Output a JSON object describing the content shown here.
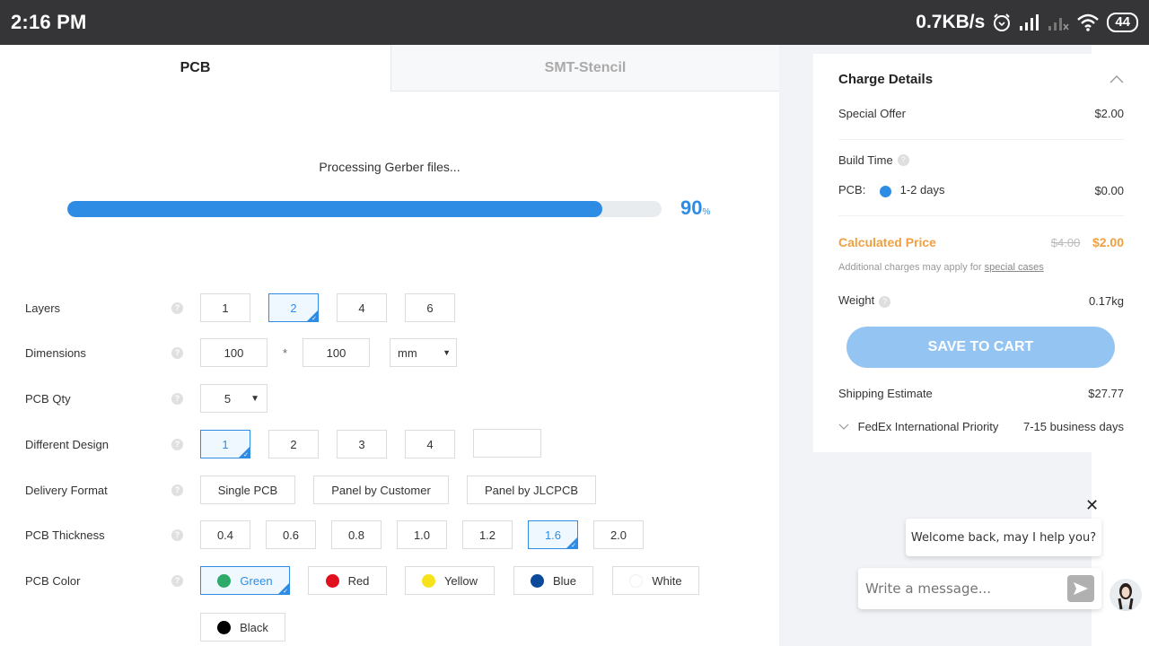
{
  "status_bar": {
    "time": "2:16 PM",
    "net_speed": "0.7KB/s",
    "battery": "44",
    "icons": [
      "alarm-icon",
      "signal-icon",
      "signal-no-service-icon",
      "wifi-icon",
      "battery-icon"
    ]
  },
  "tabs": [
    {
      "label": "PCB",
      "active": true
    },
    {
      "label": "SMT-Stencil",
      "active": false
    }
  ],
  "progress": {
    "label": "Processing Gerber files...",
    "percent": 90,
    "percent_text": "90",
    "percent_unit": "%"
  },
  "form": {
    "layers": {
      "label": "Layers",
      "options": [
        "1",
        "2",
        "4",
        "6"
      ],
      "selected": "2"
    },
    "dimensions": {
      "label": "Dimensions",
      "width": "100",
      "separator": "*",
      "height": "100",
      "unit": "mm"
    },
    "qty": {
      "label": "PCB Qty",
      "value": "5"
    },
    "different_design": {
      "label": "Different Design",
      "options": [
        "1",
        "2",
        "3",
        "4"
      ],
      "selected": "1",
      "custom_value": ""
    },
    "delivery_format": {
      "label": "Delivery Format",
      "options": [
        "Single PCB",
        "Panel by Customer",
        "Panel by JLCPCB"
      ]
    },
    "thickness": {
      "label": "PCB Thickness",
      "options": [
        "0.4",
        "0.6",
        "0.8",
        "1.0",
        "1.2",
        "1.6",
        "2.0"
      ],
      "selected": "1.6"
    },
    "color": {
      "label": "PCB Color",
      "selected": "Green",
      "options": [
        {
          "label": "Green",
          "hex": "#2eaa6a"
        },
        {
          "label": "Red",
          "hex": "#e0101e"
        },
        {
          "label": "Yellow",
          "hex": "#f7e31c"
        },
        {
          "label": "Blue",
          "hex": "#0b4a9a"
        },
        {
          "label": "White",
          "hex": "#ffffff"
        },
        {
          "label": "Black",
          "hex": "#000000"
        }
      ]
    },
    "help_glyph": "?"
  },
  "charge": {
    "title": "Charge Details",
    "special_offer_label": "Special Offer",
    "special_offer_value": "$2.00",
    "build_time_label": "Build Time",
    "pcb_label": "PCB:",
    "build_option": "1-2 days",
    "build_price": "$0.00",
    "calculated_label": "Calculated Price",
    "old_price": "$4.00",
    "price": "$2.00",
    "note_prefix": "Additional charges may apply for ",
    "note_link": "special cases",
    "weight_label": "Weight",
    "weight_value": "0.17kg",
    "cart_button": "SAVE TO CART",
    "shipping_label": "Shipping Estimate",
    "shipping_value": "$27.77",
    "carrier": "FedEx International Priority",
    "carrier_time": "7-15 business days"
  },
  "chat": {
    "greeting": "Welcome back, may I help you?",
    "placeholder": "Write a message...",
    "close_glyph": "✕"
  },
  "colors": {
    "accent": "#2f8ce5",
    "price": "#f0a040",
    "cart_button": "#94c4f2"
  }
}
